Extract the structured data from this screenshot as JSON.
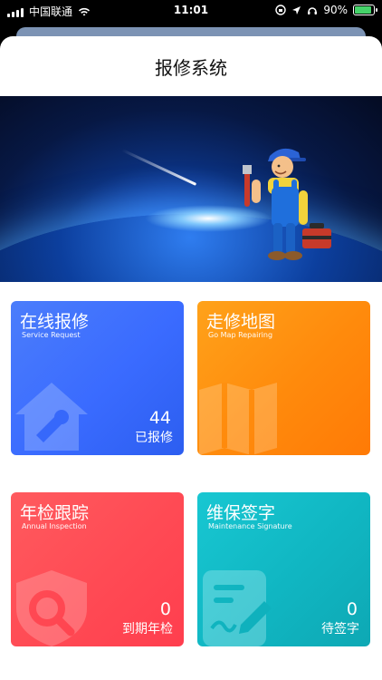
{
  "status_bar": {
    "carrier": "中国联通",
    "time": "11:01",
    "battery": "90%"
  },
  "app": {
    "title": "报修系统"
  },
  "cards": [
    {
      "title": "在线报修",
      "subtitle": "Service Request",
      "count": "44",
      "label": "已报修",
      "color": "#3a6bff",
      "icon": "house-wrench-icon"
    },
    {
      "title": "走修地图",
      "subtitle": "Go Map Repairing",
      "count": "",
      "label": "",
      "color": "#ff8a0c",
      "icon": "folded-map-icon"
    },
    {
      "title": "年检跟踪",
      "subtitle": "Annual Inspection",
      "count": "0",
      "label": "到期年检",
      "color": "#ff4a54",
      "icon": "shield-search-icon"
    },
    {
      "title": "维保签字",
      "subtitle": "Maintenance Signature",
      "count": "0",
      "label": "待签字",
      "color": "#10b6c2",
      "icon": "signature-document-icon"
    }
  ]
}
